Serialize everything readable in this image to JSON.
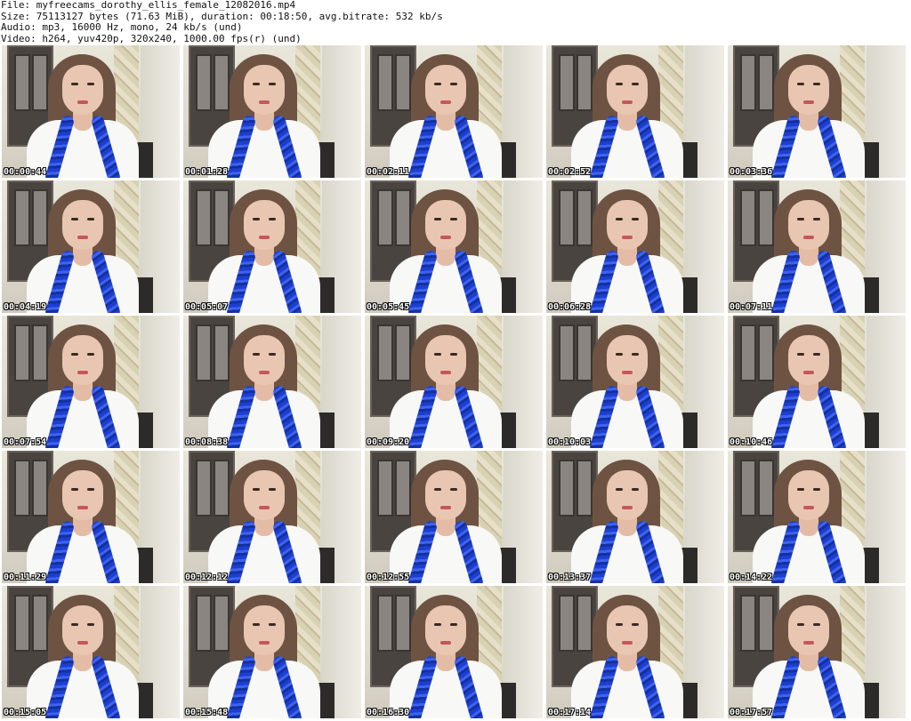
{
  "header": {
    "file_line": "File: myfreecams_dorothy_ellis_female_12082016.mp4",
    "size_line": "Size: 75113127 bytes (71.63 MiB), duration: 00:18:50, avg.bitrate: 532 kb/s",
    "audio_line": "Audio: mp3, 16000 Hz, mono, 24 kb/s (und)",
    "video_line": "Video: h264, yuv420p, 320x240, 1000.00 fps(r) (und)"
  },
  "colors": {
    "background": "#ffffff",
    "boa_blue": "#1d3fcf",
    "shirt_white": "#f8f8f6",
    "hair_brown": "#6e5342"
  },
  "thumbnails": [
    {
      "timestamp": "00:00:44"
    },
    {
      "timestamp": "00:01:28"
    },
    {
      "timestamp": "00:02:11"
    },
    {
      "timestamp": "00:02:52"
    },
    {
      "timestamp": "00:03:36"
    },
    {
      "timestamp": "00:04:19"
    },
    {
      "timestamp": "00:05:07"
    },
    {
      "timestamp": "00:05:45"
    },
    {
      "timestamp": "00:06:28"
    },
    {
      "timestamp": "00:07:11"
    },
    {
      "timestamp": "00:07:54"
    },
    {
      "timestamp": "00:08:38"
    },
    {
      "timestamp": "00:09:20"
    },
    {
      "timestamp": "00:10:03"
    },
    {
      "timestamp": "00:10:46"
    },
    {
      "timestamp": "00:11:29"
    },
    {
      "timestamp": "00:12:12"
    },
    {
      "timestamp": "00:12:55"
    },
    {
      "timestamp": "00:13:37"
    },
    {
      "timestamp": "00:14:22"
    },
    {
      "timestamp": "00:15:05"
    },
    {
      "timestamp": "00:15:48"
    },
    {
      "timestamp": "00:16:30"
    },
    {
      "timestamp": "00:17:14"
    },
    {
      "timestamp": "00:17:57"
    }
  ]
}
